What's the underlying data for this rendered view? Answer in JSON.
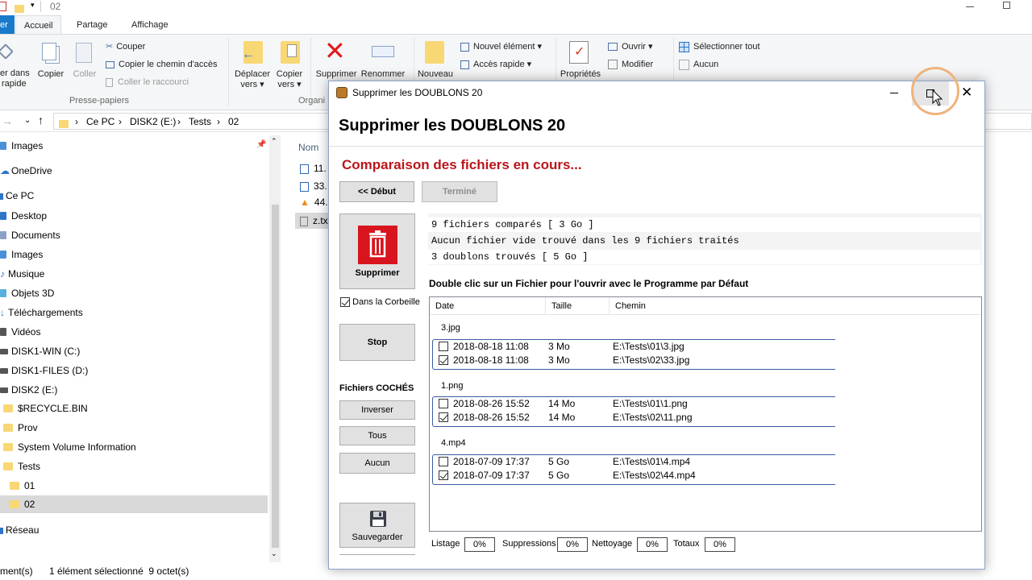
{
  "explorer": {
    "window_title": "02",
    "ribbon_tabs": [
      "er",
      "Accueil",
      "Partage",
      "Affichage"
    ],
    "ribbon": {
      "pin_label": "er dans",
      "pin_label2": "rapide",
      "copy": "Copier",
      "paste": "Coller",
      "cut": "Couper",
      "copy_path": "Copier le chemin d'accès",
      "paste_shortcut": "Coller le raccourci",
      "group_clipboard": "Presse-papiers",
      "move_to": "Déplacer",
      "move_to2": "vers",
      "copy_to": "Copier",
      "copy_to2": "vers",
      "delete": "Supprimer",
      "rename": "Renommer",
      "group_organize": "Organi",
      "new": "Nouveau",
      "new_item": "Nouvel élément",
      "easy_access": "Accès rapide",
      "properties": "Propriétés",
      "open": "Ouvrir",
      "edit": "Modifier",
      "select_all": "Sélectionner tout",
      "select_none": "Aucun"
    },
    "breadcrumb": [
      "Ce PC",
      "DISK2 (E:)",
      "Tests",
      "02"
    ],
    "column_header": "Nom",
    "files": [
      "11.",
      "33.",
      "44.",
      "z.tx"
    ],
    "tree": [
      {
        "label": "Images",
        "kind": "pinned"
      },
      {
        "label": "OneDrive",
        "kind": "cloud"
      },
      {
        "label": "Ce PC",
        "kind": "pc"
      },
      {
        "label": "Desktop",
        "kind": "folder"
      },
      {
        "label": "Documents",
        "kind": "folder"
      },
      {
        "label": "Images",
        "kind": "folder"
      },
      {
        "label": "Musique",
        "kind": "folder"
      },
      {
        "label": "Objets 3D",
        "kind": "folder"
      },
      {
        "label": "Téléchargements",
        "kind": "folder"
      },
      {
        "label": "Vidéos",
        "kind": "folder"
      },
      {
        "label": "DISK1-WIN (C:)",
        "kind": "drive"
      },
      {
        "label": "DISK1-FILES (D:)",
        "kind": "drive"
      },
      {
        "label": "DISK2 (E:)",
        "kind": "drive"
      },
      {
        "label": "$RECYCLE.BIN",
        "kind": "folder"
      },
      {
        "label": "Prov",
        "kind": "folder"
      },
      {
        "label": "System Volume Information",
        "kind": "folder"
      },
      {
        "label": "Tests",
        "kind": "folder"
      },
      {
        "label": "01",
        "kind": "folder"
      },
      {
        "label": "02",
        "kind": "folder"
      },
      {
        "label": "Réseau",
        "kind": "network"
      }
    ],
    "status_items": "ment(s)",
    "status_selected": "1 élément sélectionné  9 octet(s)"
  },
  "dialog": {
    "window_title": "Supprimer les DOUBLONS 20",
    "heading": "Supprimer les DOUBLONS 20",
    "status": "Comparaison des fichiers en cours...",
    "btn_start": "<< Début",
    "btn_done": "Terminé",
    "log": [
      "9 fichiers comparés [ 3 Go ]",
      "Aucun fichier vide trouvé dans les 9 fichiers traités",
      "3 doublons trouvés [ 5 Go ]"
    ],
    "btn_delete": "Supprimer",
    "recycle_label": "Dans la Corbeille",
    "recycle_checked": true,
    "btn_stop": "Stop",
    "checked_files_label": "Fichiers COCHÉS",
    "btn_invert": "Inverser",
    "btn_all": "Tous",
    "btn_none": "Aucun",
    "btn_save": "Sauvegarder",
    "hint": "Double clic sur un Fichier pour l'ouvrir avec le Programme par Défaut",
    "columns": [
      "Date",
      "Taille",
      "Chemin"
    ],
    "groups": [
      {
        "name": "3.jpg",
        "rows": [
          {
            "checked": false,
            "date": "2018-08-18 11:08",
            "size": "3 Mo",
            "path": "E:\\Tests\\01\\3.jpg"
          },
          {
            "checked": true,
            "date": "2018-08-18 11:08",
            "size": "3 Mo",
            "path": "E:\\Tests\\02\\33.jpg"
          }
        ]
      },
      {
        "name": "1.png",
        "rows": [
          {
            "checked": false,
            "date": "2018-08-26 15:52",
            "size": "14 Mo",
            "path": "E:\\Tests\\01\\1.png"
          },
          {
            "checked": true,
            "date": "2018-08-26 15:52",
            "size": "14 Mo",
            "path": "E:\\Tests\\02\\11.png"
          }
        ]
      },
      {
        "name": "4.mp4",
        "rows": [
          {
            "checked": false,
            "date": "2018-07-09 17:37",
            "size": "5 Go",
            "path": "E:\\Tests\\01\\4.mp4"
          },
          {
            "checked": true,
            "date": "2018-07-09 17:37",
            "size": "5 Go",
            "path": "E:\\Tests\\02\\44.mp4"
          }
        ]
      }
    ],
    "progress": [
      {
        "label": "Listage",
        "value": "0%"
      },
      {
        "label": "Suppressions",
        "value": "0%"
      },
      {
        "label": "Nettoyage",
        "value": "0%"
      },
      {
        "label": "Totaux",
        "value": "0%"
      }
    ]
  },
  "colors": {
    "status_red": "#b8161b",
    "delete_red": "#d8151e",
    "accent_blue": "#3c5aa0",
    "highlight_ring": "#f0b27a"
  }
}
